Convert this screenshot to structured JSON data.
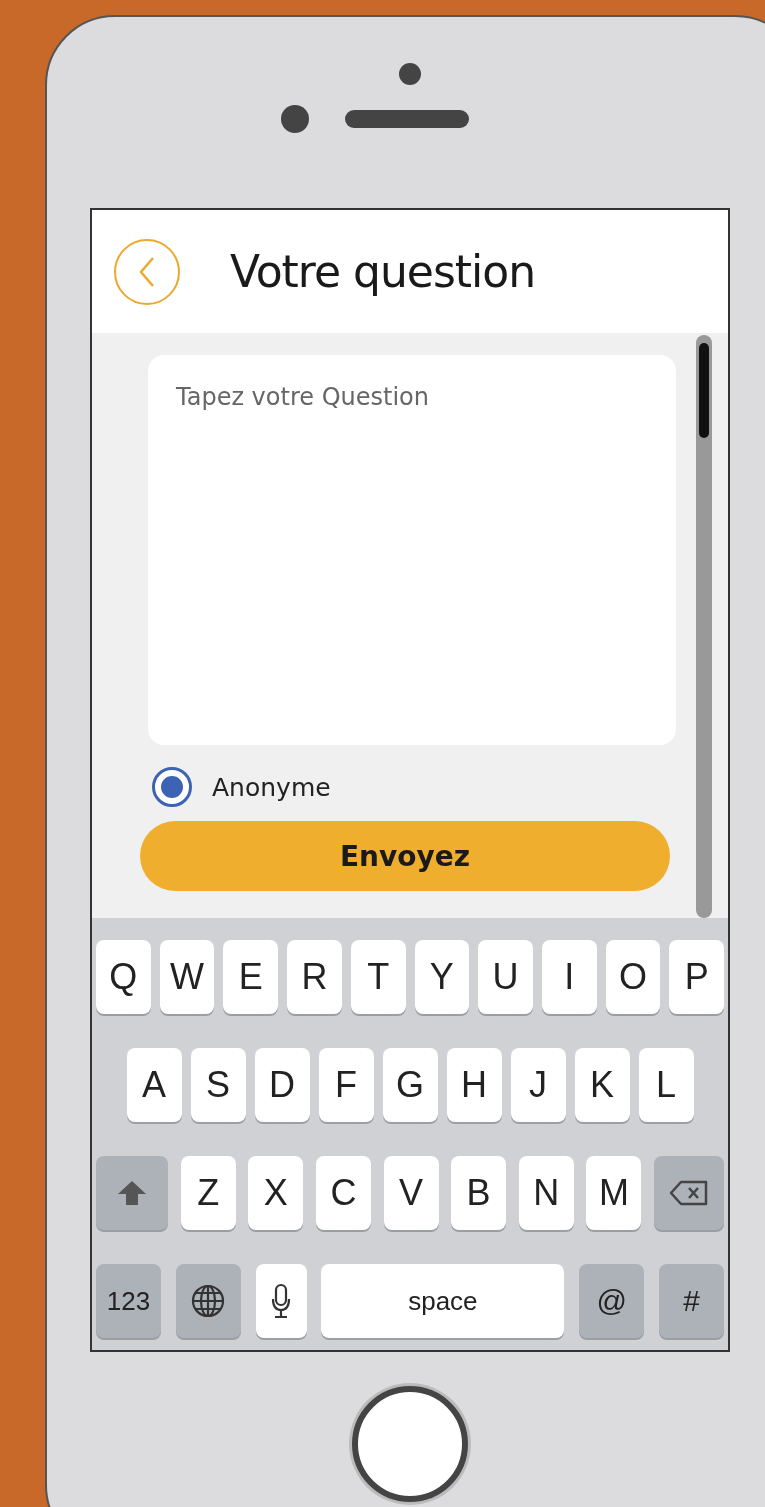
{
  "header": {
    "title": "Votre question"
  },
  "question_field": {
    "placeholder": "Tapez votre Question"
  },
  "anonymous_option": {
    "label": "Anonyme",
    "selected": true
  },
  "submit_button": {
    "label": "Envoyez"
  },
  "keyboard": {
    "rows": [
      {
        "keys": [
          {
            "kind": "letter",
            "label": "Q"
          },
          {
            "kind": "letter",
            "label": "W"
          },
          {
            "kind": "letter",
            "label": "E"
          },
          {
            "kind": "letter",
            "label": "R"
          },
          {
            "kind": "letter",
            "label": "T"
          },
          {
            "kind": "letter",
            "label": "Y"
          },
          {
            "kind": "letter",
            "label": "U"
          },
          {
            "kind": "letter",
            "label": "I"
          },
          {
            "kind": "letter",
            "label": "O"
          },
          {
            "kind": "letter",
            "label": "P"
          }
        ]
      },
      {
        "keys": [
          {
            "kind": "letter",
            "label": "A"
          },
          {
            "kind": "letter",
            "label": "S"
          },
          {
            "kind": "letter",
            "label": "D"
          },
          {
            "kind": "letter",
            "label": "F"
          },
          {
            "kind": "letter",
            "label": "G"
          },
          {
            "kind": "letter",
            "label": "H"
          },
          {
            "kind": "letter",
            "label": "J"
          },
          {
            "kind": "letter",
            "label": "K"
          },
          {
            "kind": "letter",
            "label": "L"
          }
        ]
      },
      {
        "keys": [
          {
            "kind": "shift"
          },
          {
            "kind": "letter",
            "label": "Z"
          },
          {
            "kind": "letter",
            "label": "X"
          },
          {
            "kind": "letter",
            "label": "C"
          },
          {
            "kind": "letter",
            "label": "V"
          },
          {
            "kind": "letter",
            "label": "B"
          },
          {
            "kind": "letter",
            "label": "N"
          },
          {
            "kind": "letter",
            "label": "M"
          },
          {
            "kind": "backspace"
          }
        ]
      },
      {
        "keys": [
          {
            "kind": "mode",
            "label": "123"
          },
          {
            "kind": "globe"
          },
          {
            "kind": "mic"
          },
          {
            "kind": "space",
            "label": "space"
          },
          {
            "kind": "symbol",
            "label": "@"
          },
          {
            "kind": "symbol",
            "label": "#"
          }
        ]
      }
    ]
  }
}
